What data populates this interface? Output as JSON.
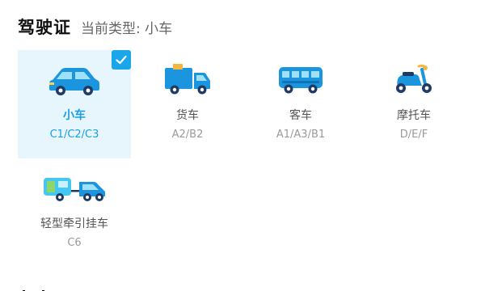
{
  "header": {
    "title": "驾驶证",
    "current_type_label": "当前类型: 小车"
  },
  "colors": {
    "accent": "#1ba5eb",
    "selected_bg": "#e7f5fd",
    "name_text": "#555555",
    "code_text": "#9a9a9a"
  },
  "cards": [
    {
      "name": "小车",
      "code": "C1/C2/C3",
      "icon": "car-icon",
      "selected": true
    },
    {
      "name": "货车",
      "code": "A2/B2",
      "icon": "truck-icon",
      "selected": false
    },
    {
      "name": "客车",
      "code": "A1/A3/B1",
      "icon": "bus-icon",
      "selected": false
    },
    {
      "name": "摩托车",
      "code": "D/E/F",
      "icon": "scooter-icon",
      "selected": false
    },
    {
      "name": "轻型牵引挂车",
      "code": "C6",
      "icon": "trailer-truck-icon",
      "selected": false
    }
  ]
}
